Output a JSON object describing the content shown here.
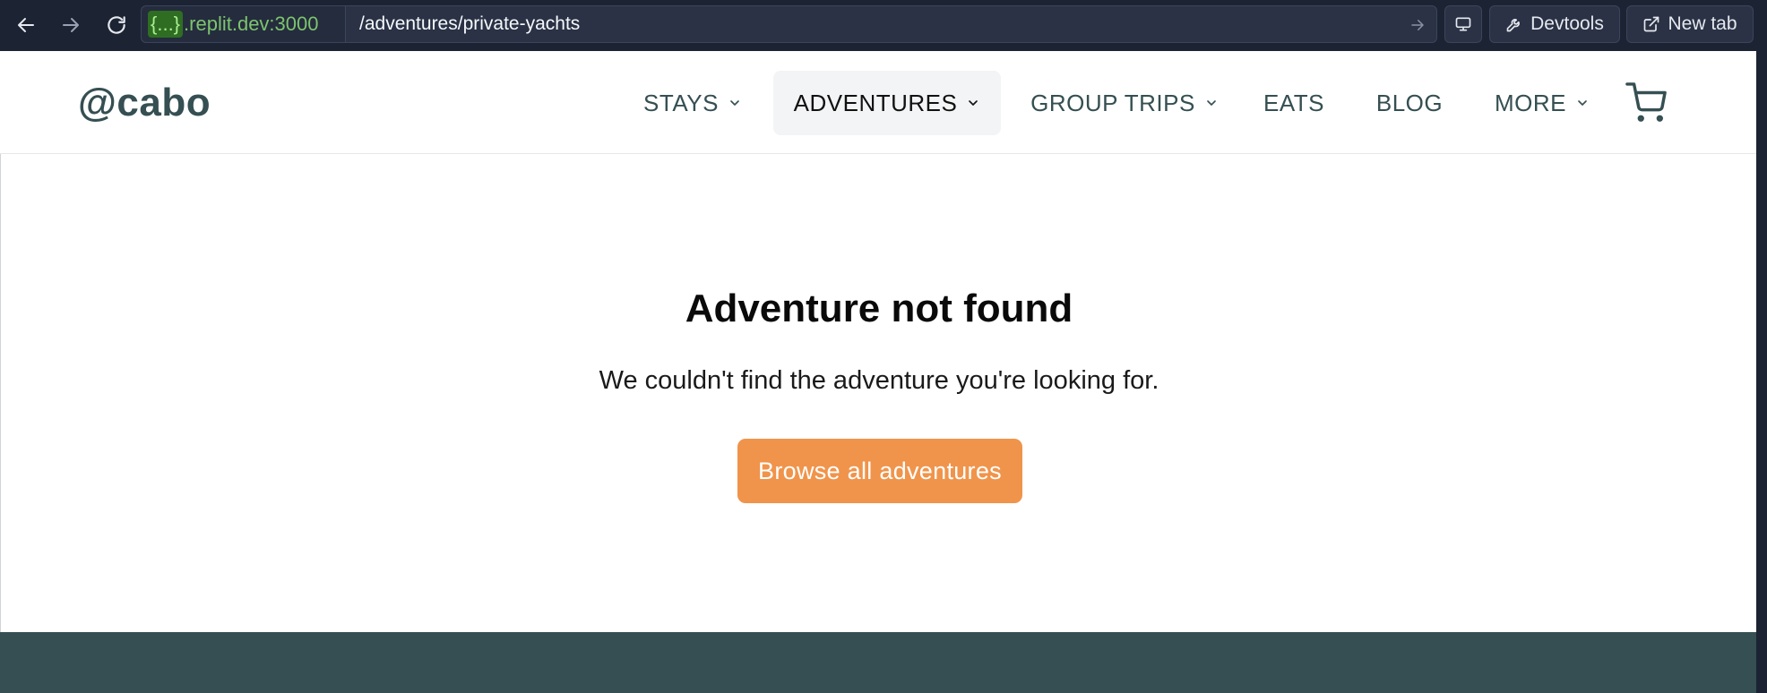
{
  "browser": {
    "url_host_badge": "{...}",
    "url_host": ".replit.dev:3000",
    "url_path": "/adventures/private-yachts",
    "devtools_label": "Devtools",
    "new_tab_label": "New tab",
    "icons": [
      "back-arrow-icon",
      "forward-arrow-icon",
      "reload-icon",
      "go-arrow-icon",
      "monitor-icon",
      "wrench-icon",
      "external-link-icon"
    ]
  },
  "site": {
    "logo": "@cabo",
    "nav": [
      {
        "label": "STAYS",
        "has_dropdown": true
      },
      {
        "label": "ADVENTURES",
        "has_dropdown": true,
        "active": true
      },
      {
        "label": "GROUP TRIPS",
        "has_dropdown": true
      },
      {
        "label": "EATS",
        "has_dropdown": false
      },
      {
        "label": "BLOG",
        "has_dropdown": false
      },
      {
        "label": "MORE",
        "has_dropdown": true
      }
    ],
    "cart_icon": "shopping-cart-icon"
  },
  "main": {
    "title": "Adventure not found",
    "message": "We couldn't find the adventure you're looking for.",
    "cta_label": "Browse all adventures"
  },
  "colors": {
    "chrome_bg": "#1c2333",
    "brand_dark": "#354f52",
    "cta_orange": "#f0944b",
    "url_host_green": "#7cc46e"
  }
}
